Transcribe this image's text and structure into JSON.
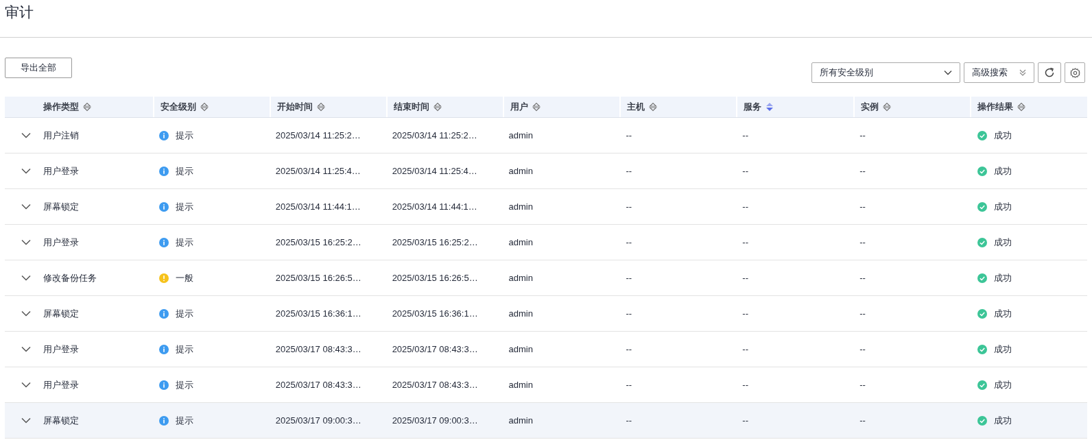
{
  "page_title": "审计",
  "export_button": "导出全部",
  "level_filter": {
    "value": "所有安全级别"
  },
  "advanced_search": "高级搜索",
  "table": {
    "columns": [
      {
        "label": "操作类型",
        "sorted": false
      },
      {
        "label": "安全级别",
        "sorted": false
      },
      {
        "label": "开始时间",
        "sorted": false
      },
      {
        "label": "结束时间",
        "sorted": false
      },
      {
        "label": "用户",
        "sorted": false
      },
      {
        "label": "主机",
        "sorted": false
      },
      {
        "label": "服务",
        "sorted": true
      },
      {
        "label": "实例",
        "sorted": false
      },
      {
        "label": "操作结果",
        "sorted": false
      }
    ],
    "rows": [
      {
        "type": "用户注销",
        "level": {
          "kind": "info",
          "text": "提示"
        },
        "start": "2025/03/14 11:25:2…",
        "end": "2025/03/14 11:25:2…",
        "user": "admin",
        "host": "--",
        "service": "--",
        "instance": "--",
        "result": {
          "kind": "success",
          "text": "成功"
        },
        "hovered": false
      },
      {
        "type": "用户登录",
        "level": {
          "kind": "info",
          "text": "提示"
        },
        "start": "2025/03/14 11:25:4…",
        "end": "2025/03/14 11:25:4…",
        "user": "admin",
        "host": "--",
        "service": "--",
        "instance": "--",
        "result": {
          "kind": "success",
          "text": "成功"
        },
        "hovered": false
      },
      {
        "type": "屏幕锁定",
        "level": {
          "kind": "info",
          "text": "提示"
        },
        "start": "2025/03/14 11:44:1…",
        "end": "2025/03/14 11:44:1…",
        "user": "admin",
        "host": "--",
        "service": "--",
        "instance": "--",
        "result": {
          "kind": "success",
          "text": "成功"
        },
        "hovered": false
      },
      {
        "type": "用户登录",
        "level": {
          "kind": "info",
          "text": "提示"
        },
        "start": "2025/03/15 16:25:2…",
        "end": "2025/03/15 16:25:2…",
        "user": "admin",
        "host": "--",
        "service": "--",
        "instance": "--",
        "result": {
          "kind": "success",
          "text": "成功"
        },
        "hovered": false
      },
      {
        "type": "修改备份任务",
        "level": {
          "kind": "warning",
          "text": "一般"
        },
        "start": "2025/03/15 16:26:5…",
        "end": "2025/03/15 16:26:5…",
        "user": "admin",
        "host": "--",
        "service": "--",
        "instance": "--",
        "result": {
          "kind": "success",
          "text": "成功"
        },
        "hovered": false
      },
      {
        "type": "屏幕锁定",
        "level": {
          "kind": "info",
          "text": "提示"
        },
        "start": "2025/03/15 16:36:1…",
        "end": "2025/03/15 16:36:1…",
        "user": "admin",
        "host": "--",
        "service": "--",
        "instance": "--",
        "result": {
          "kind": "success",
          "text": "成功"
        },
        "hovered": false
      },
      {
        "type": "用户登录",
        "level": {
          "kind": "info",
          "text": "提示"
        },
        "start": "2025/03/17 08:43:3…",
        "end": "2025/03/17 08:43:3…",
        "user": "admin",
        "host": "--",
        "service": "--",
        "instance": "--",
        "result": {
          "kind": "success",
          "text": "成功"
        },
        "hovered": false
      },
      {
        "type": "用户登录",
        "level": {
          "kind": "info",
          "text": "提示"
        },
        "start": "2025/03/17 08:43:3…",
        "end": "2025/03/17 08:43:3…",
        "user": "admin",
        "host": "--",
        "service": "--",
        "instance": "--",
        "result": {
          "kind": "success",
          "text": "成功"
        },
        "hovered": false
      },
      {
        "type": "屏幕锁定",
        "level": {
          "kind": "info",
          "text": "提示"
        },
        "start": "2025/03/17 09:00:3…",
        "end": "2025/03/17 09:00:3…",
        "user": "admin",
        "host": "--",
        "service": "--",
        "instance": "--",
        "result": {
          "kind": "success",
          "text": "成功"
        },
        "hovered": true
      }
    ]
  }
}
